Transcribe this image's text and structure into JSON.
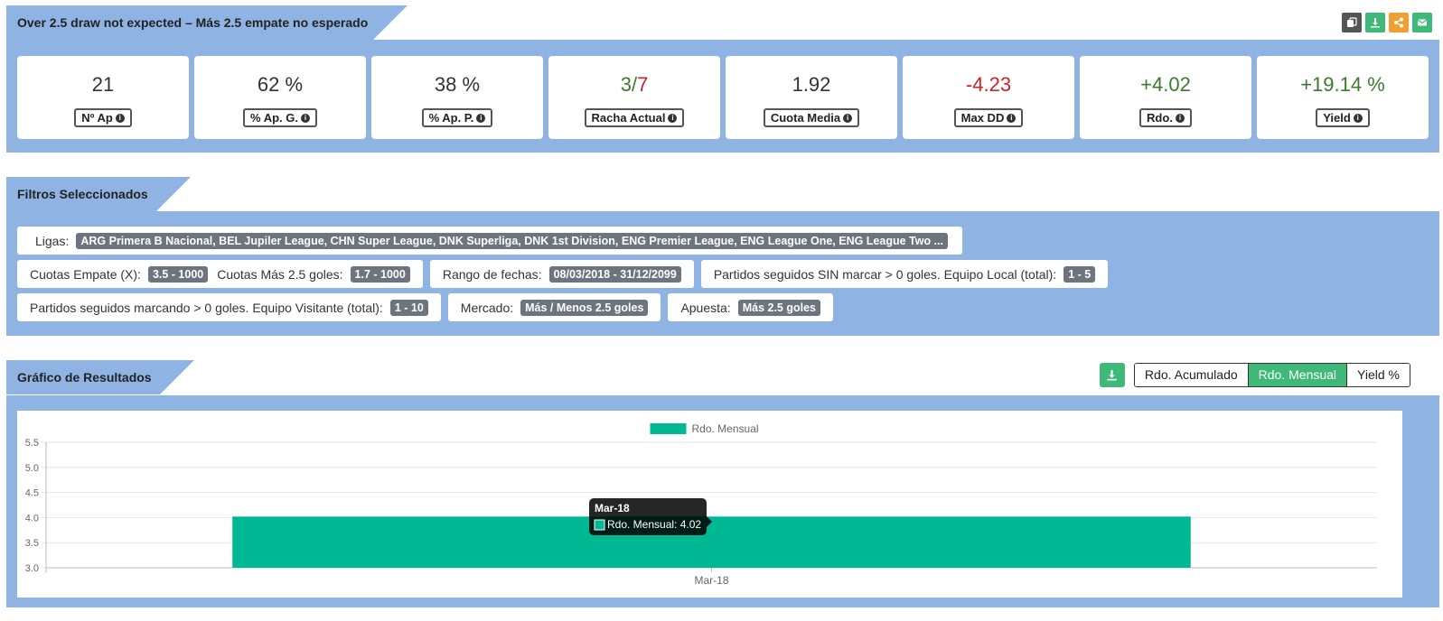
{
  "header": {
    "title": "Over 2.5 draw not expected – Más 2.5 empate no esperado",
    "icons": [
      "copy-icon",
      "download-icon",
      "share-icon",
      "envelope-icon"
    ],
    "icon_colors": [
      "#555555",
      "#3fb978",
      "#f0a030",
      "#3fb978"
    ]
  },
  "stats": [
    {
      "value": "21",
      "label": "Nº Ap"
    },
    {
      "value": "62 %",
      "label": "% Ap. G."
    },
    {
      "value": "38 %",
      "label": "% Ap. P."
    },
    {
      "value_good": "3",
      "value_sep": "/",
      "value_bad": "7",
      "label": "Racha Actual"
    },
    {
      "value": "1.92",
      "label": "Cuota Media"
    },
    {
      "value": "-4.23",
      "label": "Max DD"
    },
    {
      "value": "+4.02",
      "label": "Rdo."
    },
    {
      "value": "+19.14 %",
      "label": "Yield"
    }
  ],
  "filters": {
    "title": "Filtros Seleccionados",
    "ligas_label": "Ligas:",
    "ligas_value": "ARG Primera B Nacional, BEL Jupiler League, CHN Super League, DNK Superliga, DNK 1st Division, ENG Premier League, ENG League One, ENG League Two ...",
    "cuotas_empate_label": "Cuotas Empate (X):",
    "cuotas_empate_value": "3.5 - 1000",
    "cuotas_mas_label": "Cuotas Más 2.5 goles:",
    "cuotas_mas_value": "1.7 - 1000",
    "rango_label": "Rango de fechas:",
    "rango_value": "08/03/2018 - 31/12/2099",
    "partidos_local_label": "Partidos seguidos SIN marcar > 0 goles. Equipo Local (total):",
    "partidos_local_value": "1 - 5",
    "partidos_visit_label": "Partidos seguidos marcando > 0 goles. Equipo Visitante (total):",
    "partidos_visit_value": "1 - 10",
    "mercado_label": "Mercado:",
    "mercado_value": "Más / Menos 2.5 goles",
    "apuesta_label": "Apuesta:",
    "apuesta_value": "Más 2.5 goles"
  },
  "results": {
    "title": "Gráfico de Resultados",
    "download_icon": "download-icon",
    "tabs": [
      "Rdo. Acumulado",
      "Rdo. Mensual",
      "Yield %"
    ],
    "active_tab": "Rdo. Mensual"
  },
  "colors": {
    "panel": "#8fb4e3",
    "bar": "#00b894",
    "green_text": "#3c7a30",
    "red_text": "#d0202b"
  },
  "chart_data": {
    "type": "bar",
    "categories": [
      "Mar-18"
    ],
    "series": [
      {
        "name": "Rdo. Mensual",
        "values": [
          4.02
        ]
      }
    ],
    "ylim": [
      3.0,
      5.5
    ],
    "yticks": [
      "5.5",
      "5.0",
      "4.5",
      "4.0",
      "3.5",
      "3.0"
    ],
    "grid": true,
    "legend": "top-center",
    "tooltip": {
      "title": "Mar-18",
      "text": "Rdo. Mensual: 4.02"
    }
  }
}
